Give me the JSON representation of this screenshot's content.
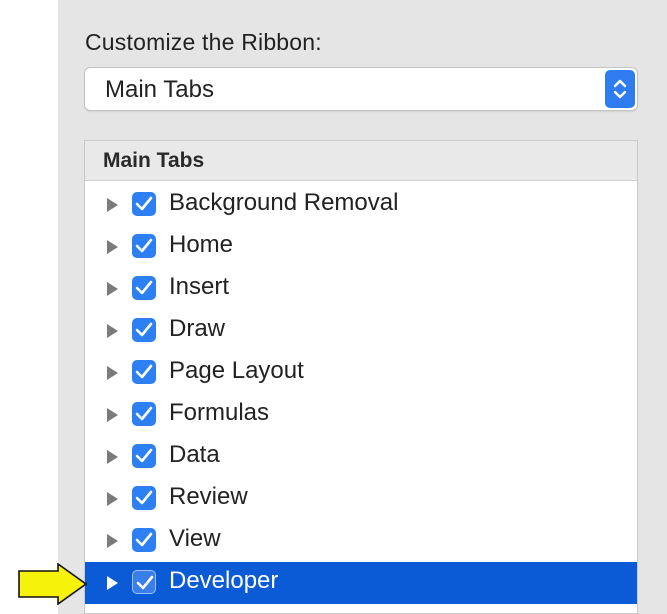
{
  "section_label": "Customize the Ribbon:",
  "dropdown": {
    "selected": "Main Tabs",
    "icon": "chevron-up-down-icon"
  },
  "list": {
    "header": "Main Tabs",
    "items": [
      {
        "label": "Background Removal",
        "checked": true,
        "selected": false
      },
      {
        "label": "Home",
        "checked": true,
        "selected": false
      },
      {
        "label": "Insert",
        "checked": true,
        "selected": false
      },
      {
        "label": "Draw",
        "checked": true,
        "selected": false
      },
      {
        "label": "Page Layout",
        "checked": true,
        "selected": false
      },
      {
        "label": "Formulas",
        "checked": true,
        "selected": false
      },
      {
        "label": "Data",
        "checked": true,
        "selected": false
      },
      {
        "label": "Review",
        "checked": true,
        "selected": false
      },
      {
        "label": "View",
        "checked": true,
        "selected": false
      },
      {
        "label": "Developer",
        "checked": true,
        "selected": true
      }
    ]
  },
  "annotation": {
    "icon": "yellow-arrow-pointer-icon",
    "color": "#f7f20a"
  },
  "colors": {
    "accent": "#2f7cf0",
    "selection": "#0a5bd5",
    "panel_background": "#e5e5e5"
  }
}
